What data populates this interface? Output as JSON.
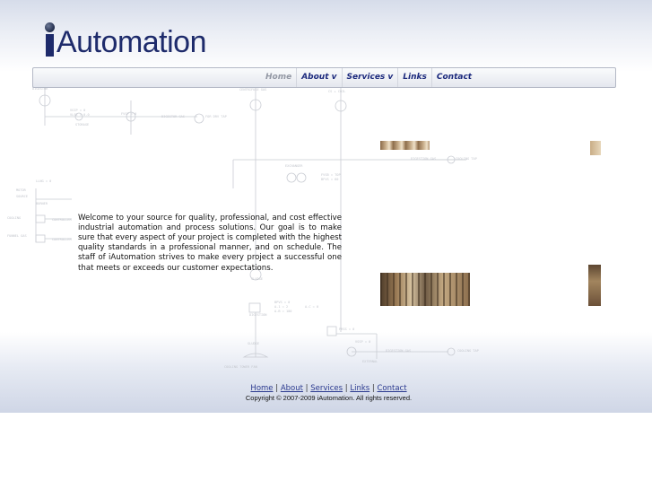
{
  "brand": {
    "name": "Automation"
  },
  "nav": {
    "items": [
      {
        "label": "Home"
      },
      {
        "label": "About v"
      },
      {
        "label": "Services v"
      },
      {
        "label": "Links"
      },
      {
        "label": "Contact"
      }
    ]
  },
  "main": {
    "intro": "Welcome to your source for quality, professional, and cost effective industrial automation and process solutions.  Our goal is to make sure that every aspect of your project is completed with the highest quality standards in a professional manner, and on schedule.  The staff of iAutomation strives to make every project a successful one that meets or exceeds our customer expectations."
  },
  "footer": {
    "links": [
      {
        "label": "Home"
      },
      {
        "label": "About"
      },
      {
        "label": "Services"
      },
      {
        "label": "Links"
      },
      {
        "label": "Contact"
      }
    ],
    "separator": "|",
    "copyright": "Copyright © 2007-2009 iAutomation.  All rights reserved."
  },
  "colors": {
    "brand_blue": "#1e2b6b",
    "nav_text": "#1c2a7d",
    "nav_active": "#9398a4",
    "link_blue": "#2b3a8f"
  }
}
